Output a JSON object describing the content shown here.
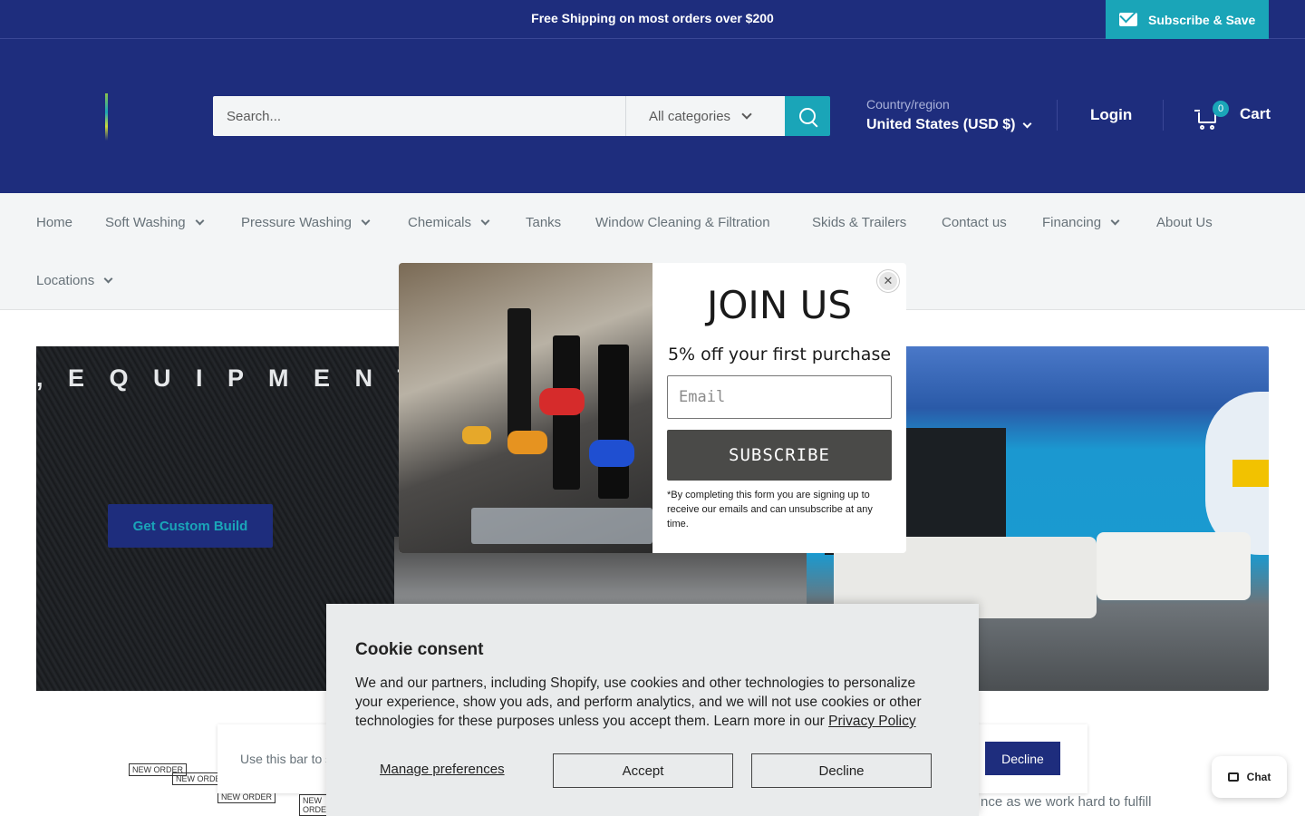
{
  "announcement": {
    "text": "Free Shipping on most orders over $200",
    "subscribe_label": "Subscribe & Save"
  },
  "header": {
    "search_placeholder": "Search...",
    "category_label": "All categories",
    "country_label": "Country/region",
    "country_value": "United States (USD $)",
    "login_label": "Login",
    "cart_count": "0",
    "cart_label": "Cart"
  },
  "nav": {
    "items": [
      {
        "label": "Home"
      },
      {
        "label": "Soft Washing"
      },
      {
        "label": "Pressure Washing"
      },
      {
        "label": "Chemicals"
      },
      {
        "label": "Tanks"
      },
      {
        "label": "Window Cleaning & Filtration"
      },
      {
        "label": "Skids & Trailers"
      },
      {
        "label": "Contact us"
      },
      {
        "label": "Financing"
      },
      {
        "label": "About Us"
      },
      {
        "label": "Locations"
      }
    ]
  },
  "hero": {
    "title": ", E Q U I P M E N T , C H E M",
    "cta_label": "Get Custom Build"
  },
  "popup": {
    "title": "JOIN US",
    "subtitle": "5% off your first purchase",
    "email_placeholder": "Email",
    "subscribe_label": "SUBSCRIBE",
    "fine_print": "*By completing this form you are signing up to receive our emails and can unsubscribe at any time.",
    "close_label": "✕"
  },
  "cookie": {
    "title": "Cookie consent",
    "text": "We and our partners, including Shopify, use cookies and other technologies to personalize your experience, show you ads, and perform analytics, and we will not use cookies or other technologies for these purposes unless you accept them. Learn more in our ",
    "link": "Privacy Policy",
    "manage_label": "Manage preferences",
    "accept_label": "Accept",
    "decline_label": "Decline"
  },
  "bottom_bar": {
    "text": "Use this bar to s",
    "decline_label": "Decline",
    "news_tags": [
      "NEW ORDER",
      "NEW ORDER",
      "NEW ORDER",
      "NEW ORDER"
    ],
    "fulfill_text": "nce as we work hard to fulfill"
  },
  "chat": {
    "label": "Chat"
  },
  "colors": {
    "primary": "#1e2d7d",
    "accent": "#1aa5b8",
    "nav_bg": "#f3f5f6"
  }
}
